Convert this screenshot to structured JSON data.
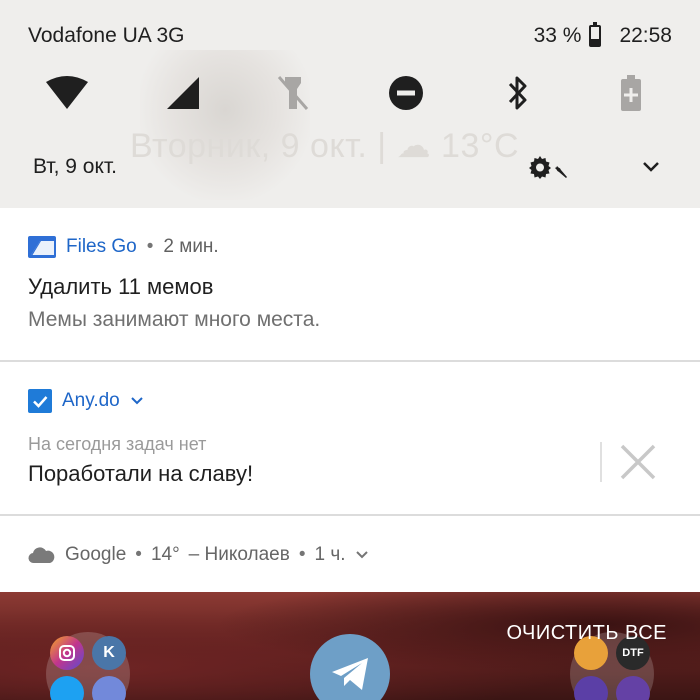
{
  "status_bar": {
    "carrier": "Vodafone UA 3G",
    "battery_percent": "33 %",
    "battery_level": 0.33,
    "time": "22:58"
  },
  "quick_settings": {
    "tiles": [
      {
        "name": "wifi",
        "icon": "wifi-icon",
        "active": true
      },
      {
        "name": "mobile-data",
        "icon": "signal-icon",
        "active": true
      },
      {
        "name": "flashlight",
        "icon": "flashlight-off-icon",
        "active": false
      },
      {
        "name": "do-not-disturb",
        "icon": "dnd-icon",
        "active": true
      },
      {
        "name": "bluetooth",
        "icon": "bluetooth-icon",
        "active": true
      },
      {
        "name": "battery-saver",
        "icon": "battery-saver-icon",
        "active": false
      }
    ],
    "date": "Вт, 9 окт.",
    "background_text": "Вторник, 9 окт. | ☁ 13°C"
  },
  "notifications": {
    "files_go": {
      "app": "Files Go",
      "time": "2 мин.",
      "title": "Удалить 11 мемов",
      "body": "Мемы занимают много места."
    },
    "anydo": {
      "app": "Any.do",
      "subtitle": "На сегодня задач нет",
      "text": "Поработали на славу!"
    },
    "google": {
      "app": "Google",
      "temp": "14°",
      "location": "– Николаев",
      "time": "1 ч."
    }
  },
  "home": {
    "clear_all": "ОЧИСТИТЬ ВСЕ",
    "folder_right_label": "DTF"
  },
  "colors": {
    "accent_blue": "#1e66c8",
    "shade_bg": "#efeeec",
    "notification_bg": "#ffffff",
    "wallpaper_red": "#8d3a34"
  }
}
